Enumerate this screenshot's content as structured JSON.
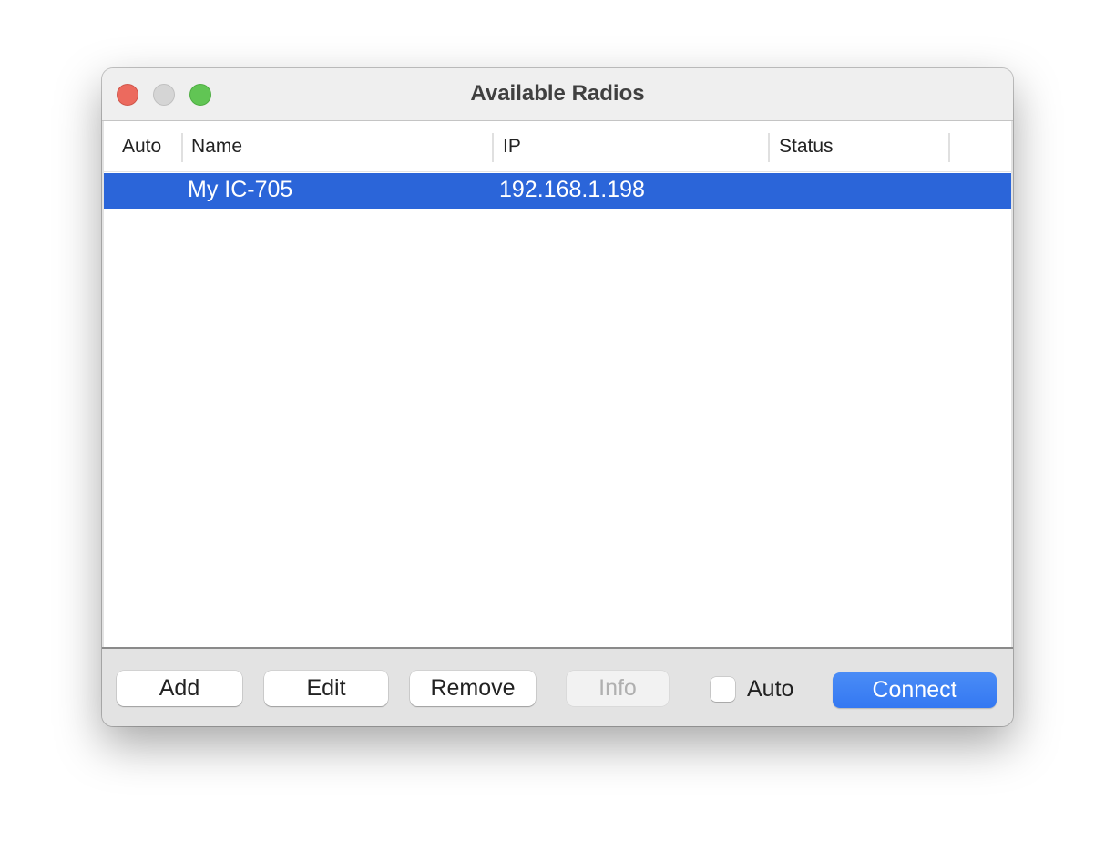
{
  "window": {
    "title": "Available Radios",
    "controls": [
      "close",
      "minimize",
      "zoom"
    ]
  },
  "table": {
    "columns": [
      "Auto",
      "Name",
      "IP",
      "Status"
    ],
    "rows": [
      {
        "auto": "",
        "name": "My IC-705",
        "ip": "192.168.1.198",
        "status": "",
        "selected": true
      }
    ]
  },
  "footer": {
    "add_label": "Add",
    "edit_label": "Edit",
    "remove_label": "Remove",
    "info_label": "Info",
    "info_enabled": false,
    "auto_checkbox_label": "Auto",
    "auto_checked": false,
    "connect_label": "Connect"
  },
  "colors": {
    "selection": "#2b65d9",
    "primary_button": "#3a7ff4",
    "close_light": "#ec6a5e",
    "zoom_light": "#61c554"
  }
}
